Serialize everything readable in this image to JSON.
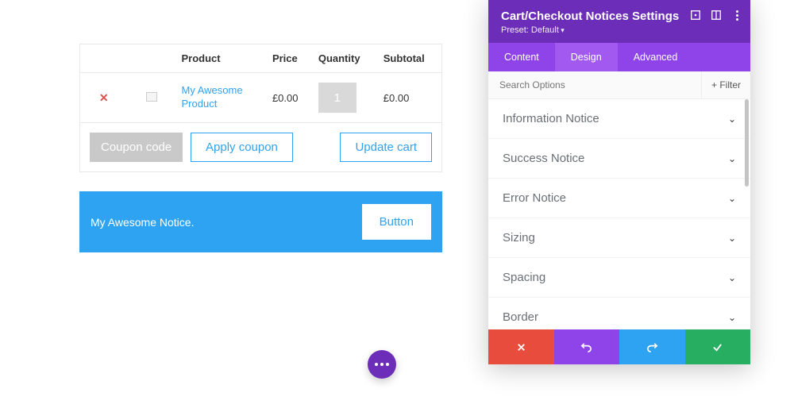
{
  "cart": {
    "headers": {
      "product": "Product",
      "price": "Price",
      "quantity": "Quantity",
      "subtotal": "Subtotal"
    },
    "item": {
      "name": "My Awesome Product",
      "price": "£0.00",
      "quantity": "1",
      "subtotal": "£0.00"
    },
    "coupon_placeholder": "Coupon code",
    "apply_label": "Apply coupon",
    "update_label": "Update cart"
  },
  "notice": {
    "text": "My Awesome Notice.",
    "button": "Button"
  },
  "panel": {
    "title": "Cart/Checkout Notices Settings",
    "preset": "Preset: Default",
    "tabs": {
      "content": "Content",
      "design": "Design",
      "advanced": "Advanced"
    },
    "search_placeholder": "Search Options",
    "filter_label": "Filter",
    "options": [
      "Information Notice",
      "Success Notice",
      "Error Notice",
      "Sizing",
      "Spacing",
      "Border"
    ]
  }
}
